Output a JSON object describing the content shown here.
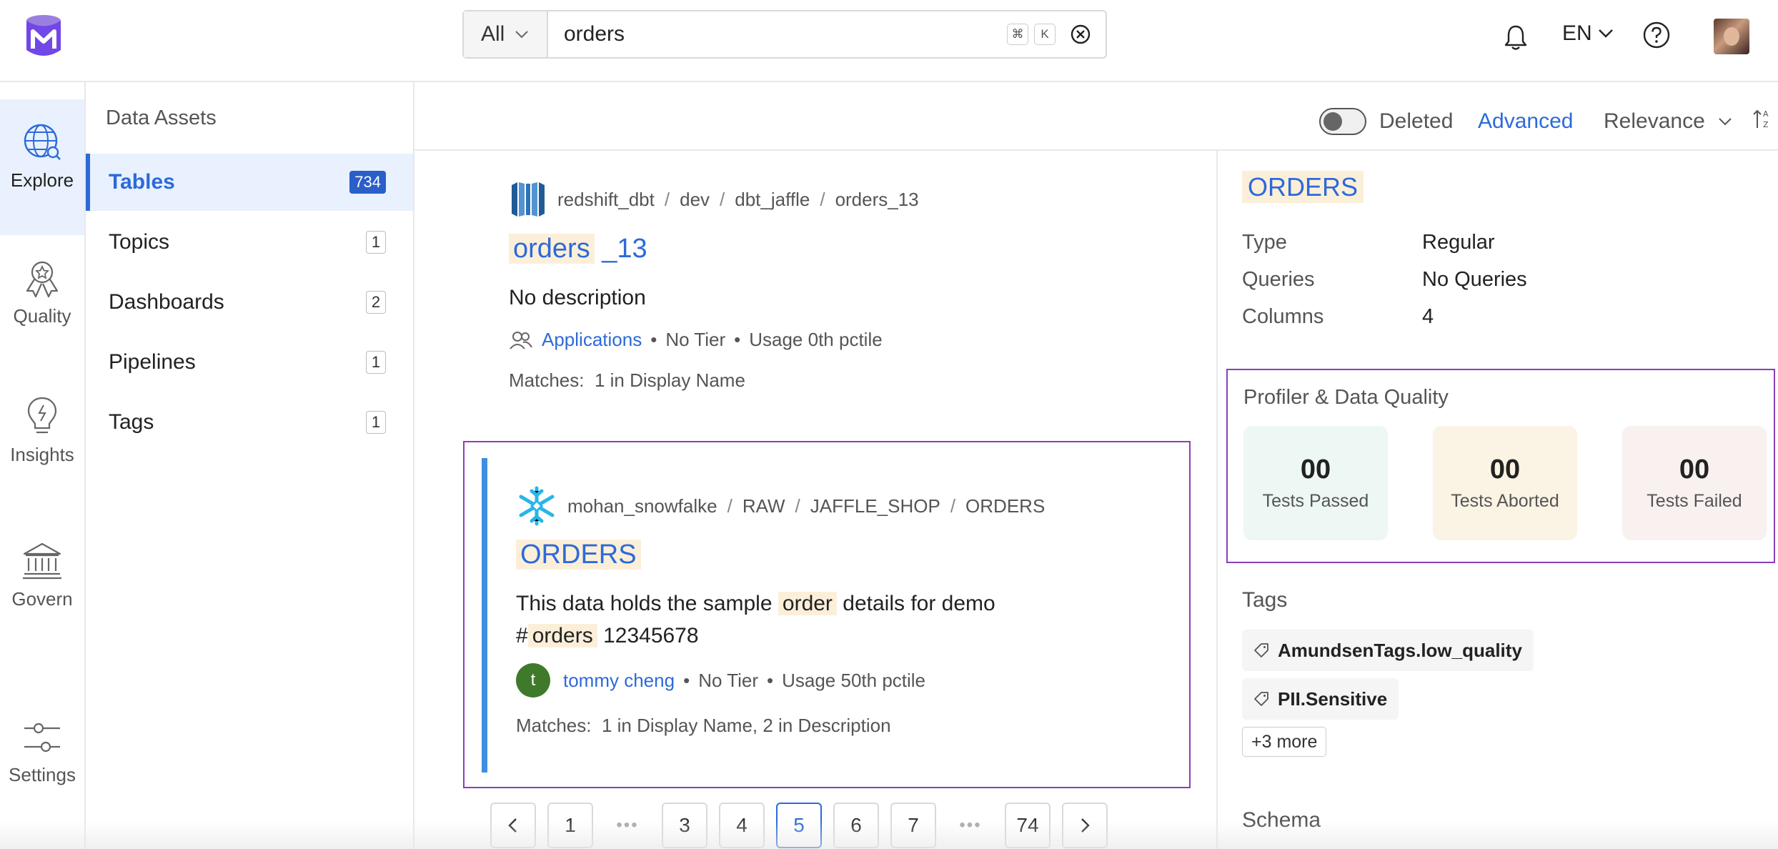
{
  "search": {
    "type": "All",
    "query": "orders",
    "shortcut": [
      "⌘",
      "K"
    ]
  },
  "header": {
    "language": "EN"
  },
  "nav": {
    "explore": "Explore",
    "quality": "Quality",
    "insights": "Insights",
    "govern": "Govern",
    "settings": "Settings"
  },
  "assets": {
    "title": "Data Assets",
    "items": [
      {
        "label": "Tables",
        "count": "734"
      },
      {
        "label": "Topics",
        "count": "1"
      },
      {
        "label": "Dashboards",
        "count": "2"
      },
      {
        "label": "Pipelines",
        "count": "1"
      },
      {
        "label": "Tags",
        "count": "1"
      }
    ]
  },
  "toolbar": {
    "deleted": "Deleted",
    "advanced": "Advanced",
    "sort": "Relevance"
  },
  "results": [
    {
      "crumbs": [
        "redshift_dbt",
        "dev",
        "dbt_jaffle",
        "orders_13"
      ],
      "title_hl": "orders",
      "title_rest": "_13",
      "description": "No description",
      "owner": "Applications",
      "tier": "No Tier",
      "usage": "Usage 0th pctile",
      "matches_label": "Matches:",
      "matches": "1 in Display Name"
    },
    {
      "crumbs": [
        "mohan_snowfalke",
        "RAW",
        "JAFFLE_SHOP",
        "ORDERS"
      ],
      "title_hl": "ORDERS",
      "desc_pre": "This data holds the sample",
      "desc_hl1": "order",
      "desc_mid": "details for demo",
      "desc_hash": "#",
      "desc_hl2": "orders",
      "desc_post": "12345678",
      "owner_initial": "t",
      "owner": "tommy cheng",
      "tier": "No Tier",
      "usage": "Usage 50th pctile",
      "matches_label": "Matches:",
      "matches": "1 in Display Name,  2 in Description"
    }
  ],
  "pagination": {
    "pages": [
      "1",
      "3",
      "4",
      "5",
      "6",
      "7",
      "74"
    ],
    "active": "5",
    "ellipsis": "•••"
  },
  "detail": {
    "title": "ORDERS",
    "props": [
      {
        "label": "Type",
        "value": "Regular"
      },
      {
        "label": "Queries",
        "value": "No Queries"
      },
      {
        "label": "Columns",
        "value": "4"
      }
    ],
    "profiler": {
      "title": "Profiler & Data Quality",
      "passed": {
        "value": "00",
        "label": "Tests Passed"
      },
      "aborted": {
        "value": "00",
        "label": "Tests Aborted"
      },
      "failed": {
        "value": "00",
        "label": "Tests Failed"
      }
    },
    "tags_title": "Tags",
    "tags": [
      "AmundsenTags.low_quality",
      "PII.Sensitive"
    ],
    "more_tags": "+3 more",
    "schema_title": "Schema"
  },
  "colors": {
    "accent": "#2d6ad9",
    "highlight": "#fcefd9",
    "focus_border": "#8a3fb8",
    "card_bar": "#3d8fe0",
    "passed_bg": "#edf7f3",
    "aborted_bg": "#fbf3e3",
    "failed_bg": "#f8f1ef"
  }
}
